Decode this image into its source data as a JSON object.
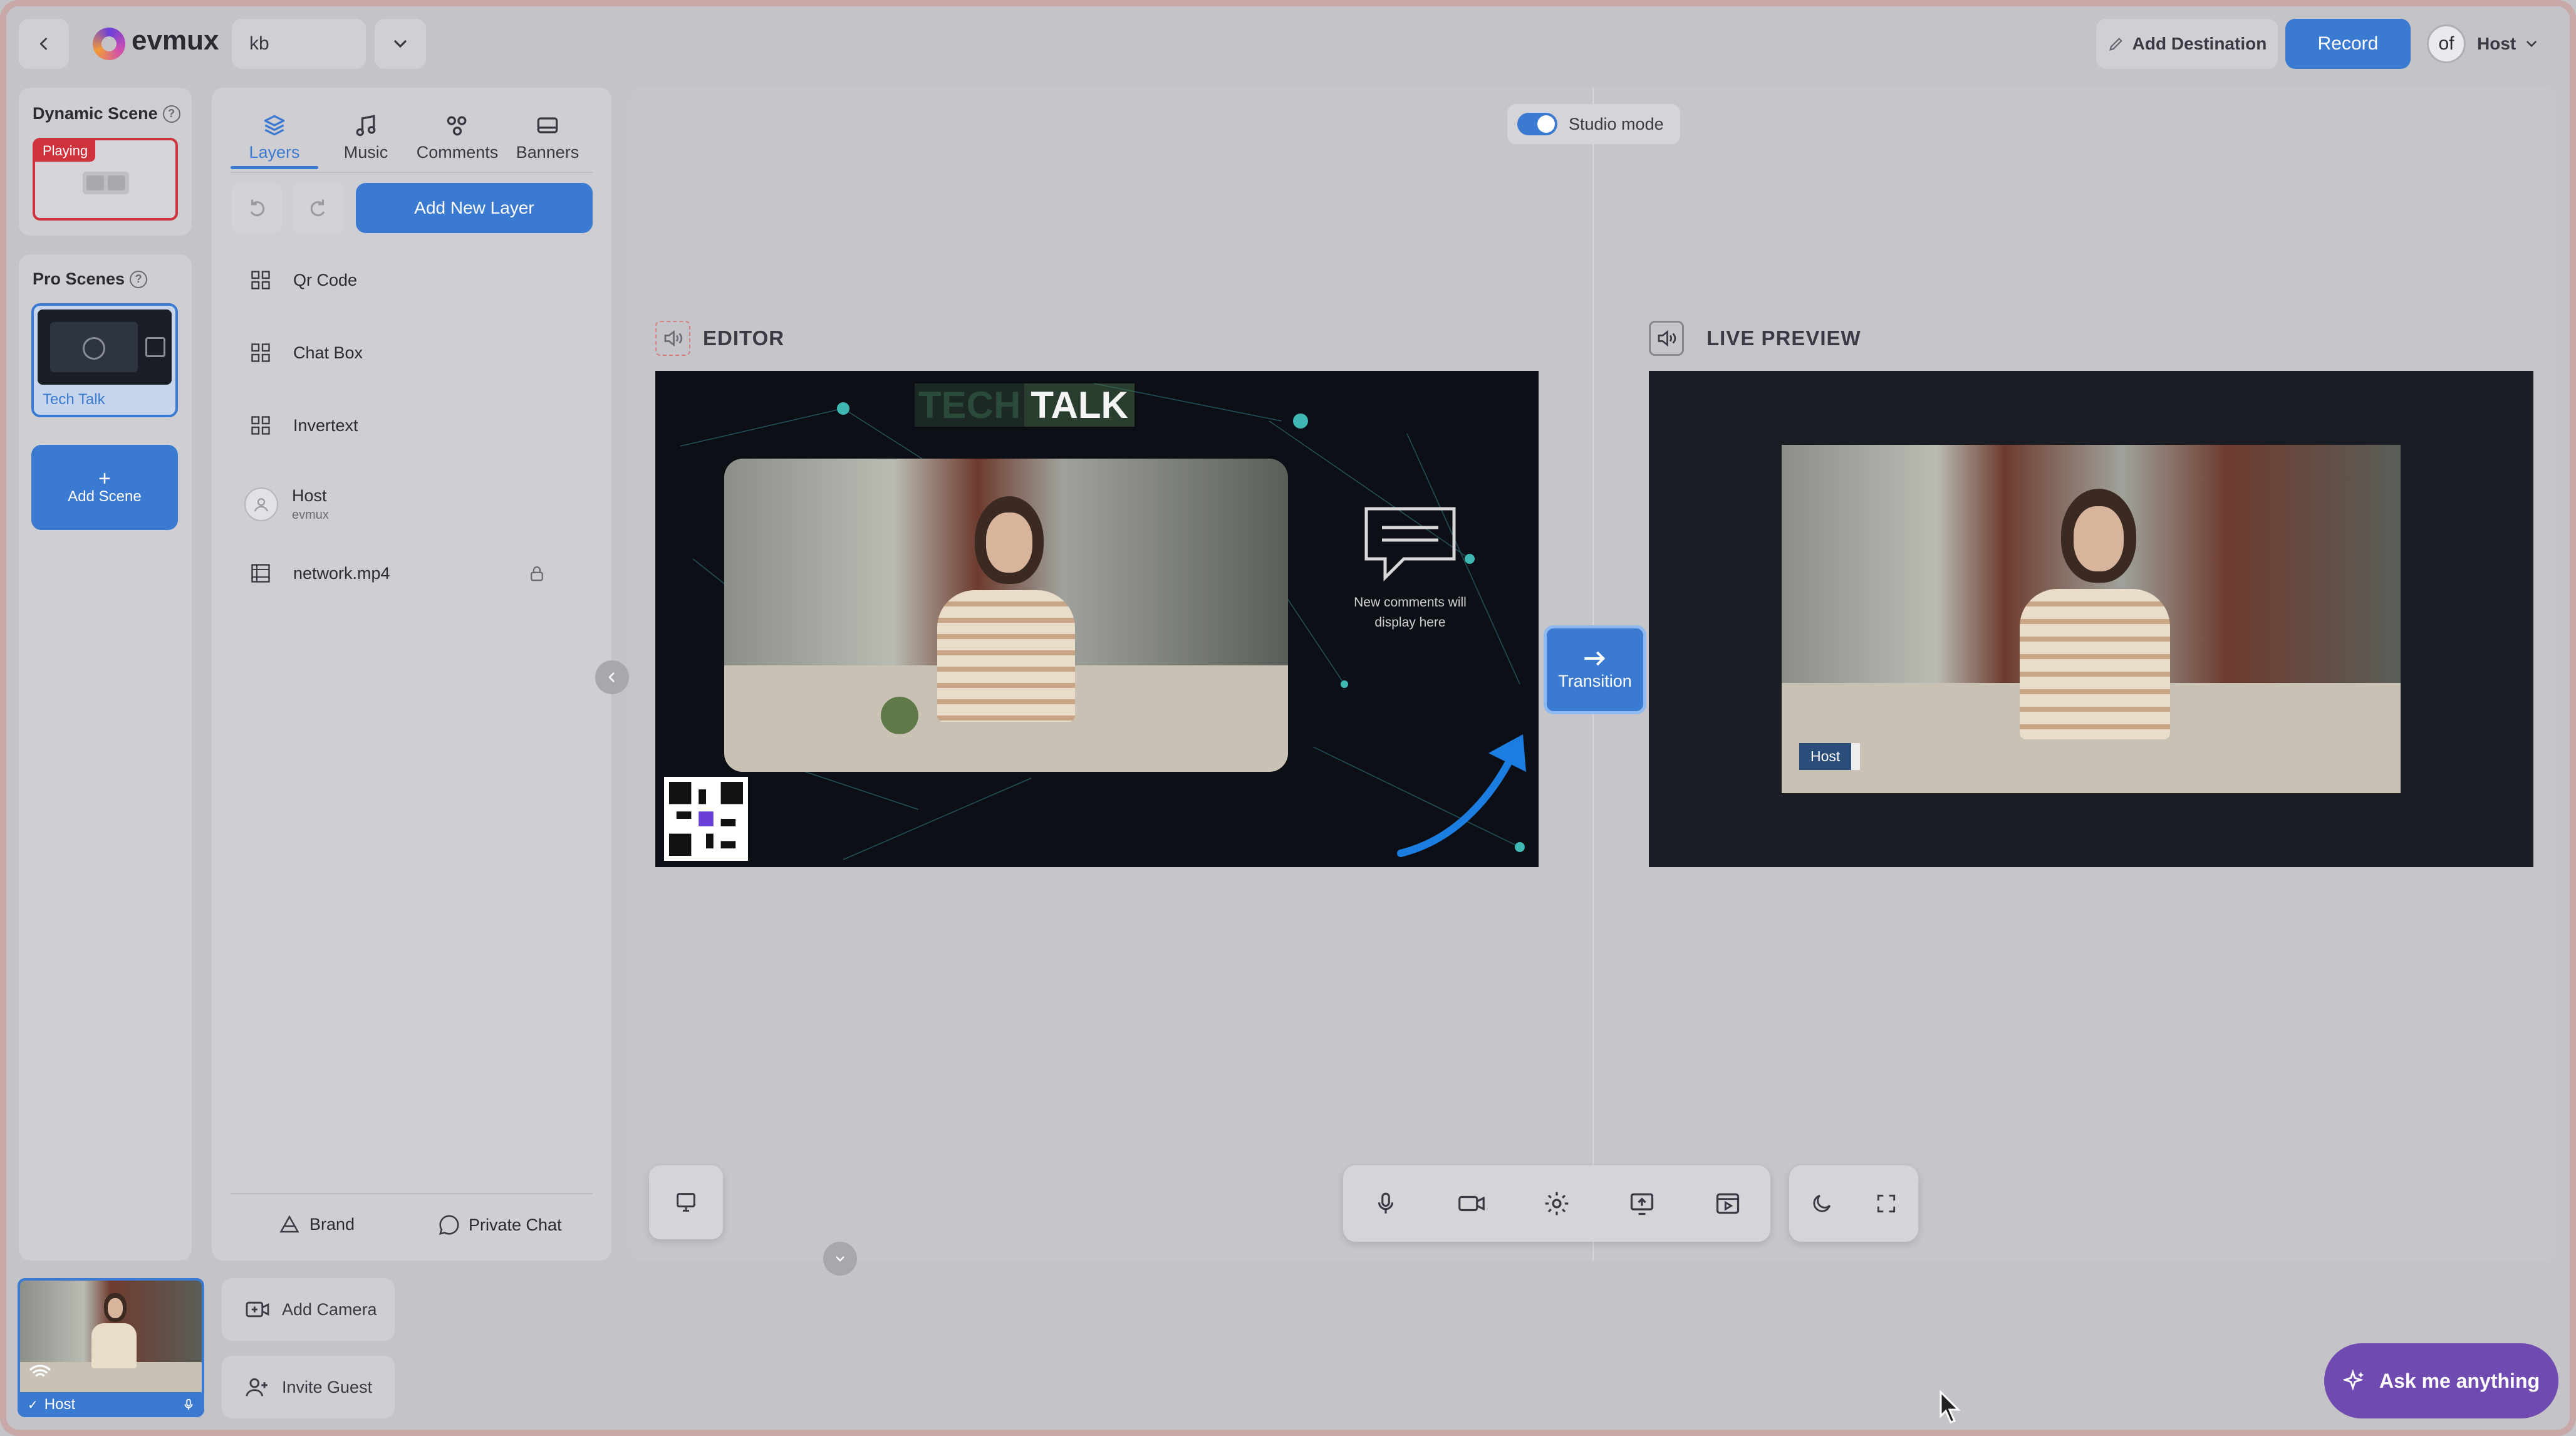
{
  "topbar": {
    "logo_text": "evmux",
    "studio_name": "kb",
    "add_destination_label": "Add Destination",
    "record_label": "Record",
    "host_avatar_text": "of",
    "host_label": "Host"
  },
  "scenes": {
    "dynamic_title": "Dynamic Scene",
    "playing_badge": "Playing",
    "pro_title": "Pro Scenes",
    "pro_items": [
      {
        "label": "Tech Talk"
      }
    ],
    "add_scene_label": "Add Scene"
  },
  "layers_panel": {
    "tabs": [
      {
        "label": "Layers",
        "icon": "layers-icon",
        "active": true
      },
      {
        "label": "Music",
        "icon": "music-icon"
      },
      {
        "label": "Comments",
        "icon": "comments-icon"
      },
      {
        "label": "Banners",
        "icon": "banners-icon"
      }
    ],
    "add_layer_label": "Add New Layer",
    "layers": [
      {
        "label": "Qr Code",
        "icon": "widget-icon"
      },
      {
        "label": "Chat Box",
        "icon": "widget-icon"
      },
      {
        "label": "Invertext",
        "icon": "widget-icon"
      },
      {
        "label": "Host",
        "sublabel": "evmux",
        "icon": "avatar-icon"
      },
      {
        "label": "network.mp4",
        "icon": "video-file-icon",
        "locked": true
      }
    ],
    "brand_label": "Brand",
    "private_chat_label": "Private Chat"
  },
  "stage": {
    "studio_mode_label": "Studio mode",
    "studio_mode_on": true,
    "editor_label": "EDITOR",
    "live_preview_label": "LIVE PREVIEW",
    "tech_text": "TECH",
    "talk_text": "TALK",
    "comments_placeholder": "New comments will display here",
    "transition_label": "Transition",
    "host_tag": "Host"
  },
  "controls": {
    "icons": [
      "microphone-icon",
      "camera-icon",
      "settings-icon",
      "share-screen-icon",
      "media-icon"
    ],
    "secondary_icons": [
      "dark-mode-icon",
      "fullscreen-icon"
    ]
  },
  "bottom": {
    "host_tile_label": "Host",
    "add_camera_label": "Add Camera",
    "invite_guest_label": "Invite Guest",
    "ask_label": "Ask me anything"
  },
  "colors": {
    "accent": "#3a7ad1",
    "playing": "#d0323c",
    "assistant": "#6f4ab0"
  }
}
